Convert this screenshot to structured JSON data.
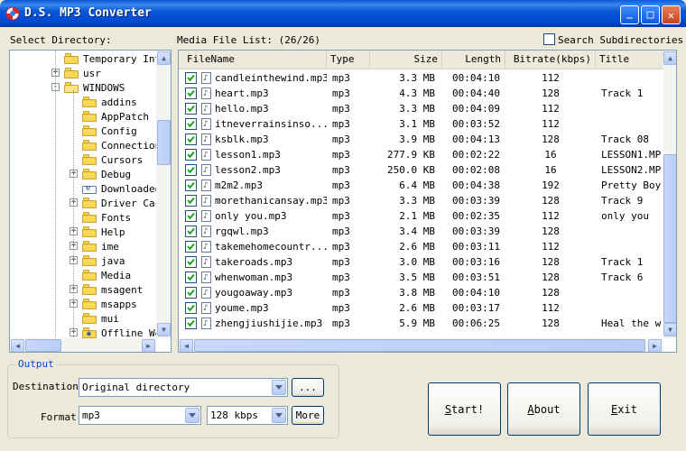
{
  "window": {
    "title": "D.S. MP3 Converter",
    "controls": {
      "minimize": "_",
      "maximize": "□",
      "close": "✕"
    }
  },
  "labels": {
    "select_directory": "Select Directory:",
    "media_file_list": "Media File List: (26/26)",
    "search_subdirectories": "Search Subdirectories"
  },
  "tree": {
    "items": [
      {
        "label": "Temporary Int",
        "level": 0,
        "expander": "",
        "icon": "folder-icon"
      },
      {
        "label": "usr",
        "level": 0,
        "expander": "+",
        "icon": "folder-icon"
      },
      {
        "label": "WINDOWS",
        "level": 0,
        "expander": "-",
        "icon": "folder-open-icon"
      },
      {
        "label": "addins",
        "level": 1,
        "expander": "",
        "icon": "folder-icon"
      },
      {
        "label": "AppPatch",
        "level": 1,
        "expander": "",
        "icon": "folder-icon"
      },
      {
        "label": "Config",
        "level": 1,
        "expander": "",
        "icon": "folder-icon"
      },
      {
        "label": "Connection",
        "level": 1,
        "expander": "",
        "icon": "folder-icon"
      },
      {
        "label": "Cursors",
        "level": 1,
        "expander": "",
        "icon": "folder-icon"
      },
      {
        "label": "Debug",
        "level": 1,
        "expander": "+",
        "icon": "folder-icon"
      },
      {
        "label": "Downloaded",
        "level": 1,
        "expander": "",
        "icon": "downloaded-folder-icon"
      },
      {
        "label": "Driver Cac",
        "level": 1,
        "expander": "+",
        "icon": "folder-icon"
      },
      {
        "label": "Fonts",
        "level": 1,
        "expander": "",
        "icon": "folder-icon"
      },
      {
        "label": "Help",
        "level": 1,
        "expander": "+",
        "icon": "folder-icon"
      },
      {
        "label": "ime",
        "level": 1,
        "expander": "+",
        "icon": "folder-icon"
      },
      {
        "label": "java",
        "level": 1,
        "expander": "+",
        "icon": "folder-icon"
      },
      {
        "label": "Media",
        "level": 1,
        "expander": "",
        "icon": "folder-icon"
      },
      {
        "label": "msagent",
        "level": 1,
        "expander": "+",
        "icon": "folder-icon"
      },
      {
        "label": "msapps",
        "level": 1,
        "expander": "+",
        "icon": "folder-icon"
      },
      {
        "label": "mui",
        "level": 1,
        "expander": "",
        "icon": "folder-icon"
      },
      {
        "label": "Offline We",
        "level": 1,
        "expander": "+",
        "icon": "offline-folder-icon"
      }
    ]
  },
  "table": {
    "columns": [
      "FileName",
      "Type",
      "Size",
      "Length",
      "Bitrate(kbps)",
      "Title"
    ],
    "rows": [
      {
        "checked": true,
        "file": "candleinthewind.mp3",
        "type": "mp3",
        "size": "3.3 MB",
        "length": "00:04:10",
        "bitrate": "112",
        "title": ""
      },
      {
        "checked": true,
        "file": "heart.mp3",
        "type": "mp3",
        "size": "4.3 MB",
        "length": "00:04:40",
        "bitrate": "128",
        "title": "Track  1"
      },
      {
        "checked": true,
        "file": "hello.mp3",
        "type": "mp3",
        "size": "3.3 MB",
        "length": "00:04:09",
        "bitrate": "112",
        "title": ""
      },
      {
        "checked": true,
        "file": "itneverrainsinso...",
        "type": "mp3",
        "size": "3.1 MB",
        "length": "00:03:52",
        "bitrate": "112",
        "title": ""
      },
      {
        "checked": true,
        "file": "ksblk.mp3",
        "type": "mp3",
        "size": "3.9 MB",
        "length": "00:04:13",
        "bitrate": "128",
        "title": "Track 08"
      },
      {
        "checked": true,
        "file": "lesson1.mp3",
        "type": "mp3",
        "size": "277.9 KB",
        "length": "00:02:22",
        "bitrate": "16",
        "title": "LESSON1.MP"
      },
      {
        "checked": true,
        "file": "lesson2.mp3",
        "type": "mp3",
        "size": "250.0 KB",
        "length": "00:02:08",
        "bitrate": "16",
        "title": "LESSON2.MP"
      },
      {
        "checked": true,
        "file": "m2m2.mp3",
        "type": "mp3",
        "size": "6.4 MB",
        "length": "00:04:38",
        "bitrate": "192",
        "title": "Pretty Boy"
      },
      {
        "checked": true,
        "file": "morethanicansay.mp3",
        "type": "mp3",
        "size": "3.3 MB",
        "length": "00:03:39",
        "bitrate": "128",
        "title": "Track  9"
      },
      {
        "checked": true,
        "file": "only you.mp3",
        "type": "mp3",
        "size": "2.1 MB",
        "length": "00:02:35",
        "bitrate": "112",
        "title": "only you"
      },
      {
        "checked": true,
        "file": "rgqwl.mp3",
        "type": "mp3",
        "size": "3.4 MB",
        "length": "00:03:39",
        "bitrate": "128",
        "title": ""
      },
      {
        "checked": true,
        "file": "takemehomecountr...",
        "type": "mp3",
        "size": "2.6 MB",
        "length": "00:03:11",
        "bitrate": "112",
        "title": ""
      },
      {
        "checked": true,
        "file": "takeroads.mp3",
        "type": "mp3",
        "size": "3.0 MB",
        "length": "00:03:16",
        "bitrate": "128",
        "title": "Track 1"
      },
      {
        "checked": true,
        "file": "whenwoman.mp3",
        "type": "mp3",
        "size": "3.5 MB",
        "length": "00:03:51",
        "bitrate": "128",
        "title": "Track 6"
      },
      {
        "checked": true,
        "file": "yougoaway.mp3",
        "type": "mp3",
        "size": "3.8 MB",
        "length": "00:04:10",
        "bitrate": "128",
        "title": ""
      },
      {
        "checked": true,
        "file": "youme.mp3",
        "type": "mp3",
        "size": "2.6 MB",
        "length": "00:03:17",
        "bitrate": "112",
        "title": ""
      },
      {
        "checked": true,
        "file": "zhengjiushijie.mp3",
        "type": "mp3",
        "size": "5.9 MB",
        "length": "00:06:25",
        "bitrate": "128",
        "title": "Heal the w"
      }
    ]
  },
  "output": {
    "group_title": "Output",
    "destination_label": "Destination:",
    "destination_value": "Original directory",
    "browse_label": "...",
    "format_label": "Format:",
    "format_value": "mp3",
    "bitrate_value": "128 kbps",
    "more_label": "More"
  },
  "buttons": {
    "start": "Start!",
    "about": "About",
    "exit": "Exit"
  },
  "colors": {
    "titlebar": "#0a5ad9",
    "group_title": "#0046d5",
    "check": "#21a121"
  }
}
